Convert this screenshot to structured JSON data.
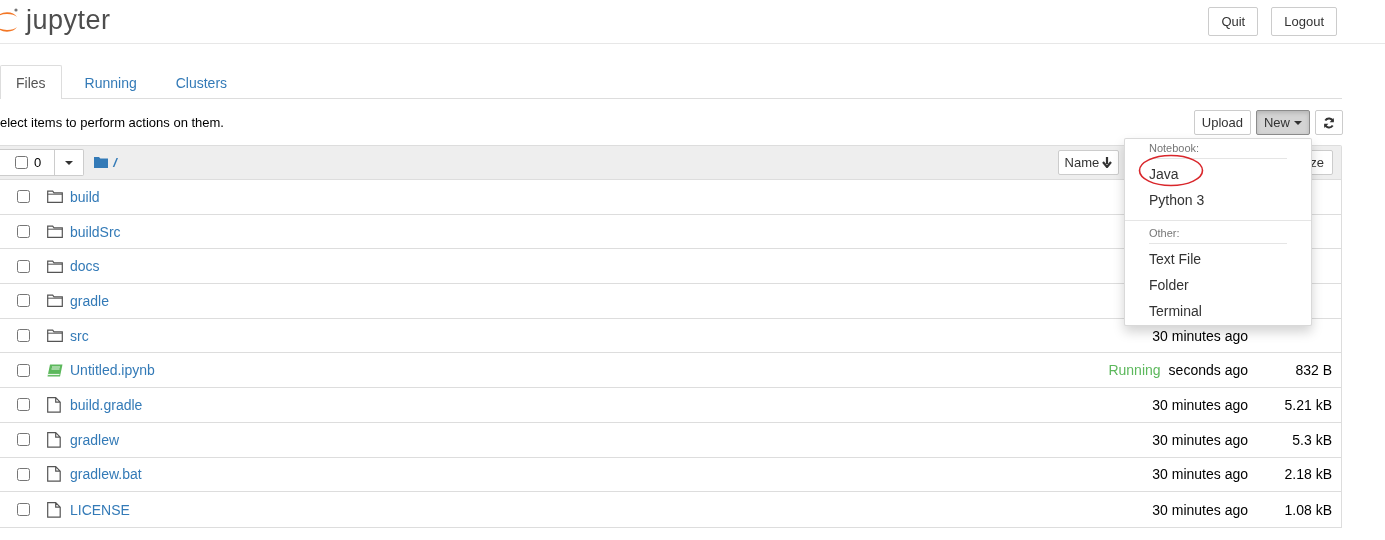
{
  "header": {
    "logo_text": "jupyter",
    "buttons": [
      "Quit",
      "Logout"
    ]
  },
  "tabs": [
    {
      "label": "Files",
      "selected": true
    },
    {
      "label": "Running",
      "selected": false
    },
    {
      "label": "Clusters",
      "selected": false
    }
  ],
  "toolbar": {
    "hint": "elect items to perform actions on them.",
    "buttons": [
      {
        "kind": "upload",
        "label": "Upload",
        "expanded": false
      },
      {
        "kind": "new",
        "label": "New",
        "expanded": true
      },
      {
        "kind": "refresh",
        "expanded": false
      }
    ]
  },
  "list_header": {
    "all_checked": false,
    "selected_count": "0",
    "path": "/",
    "sort_button": "Name",
    "column_button": "ze"
  },
  "rows": [
    {
      "kind": "folder",
      "name": "build",
      "checked": false
    },
    {
      "kind": "folder",
      "name": "buildSrc",
      "checked": false
    },
    {
      "kind": "folder",
      "name": "docs",
      "checked": false
    },
    {
      "kind": "folder",
      "name": "gradle",
      "checked": false
    },
    {
      "kind": "folder",
      "name": "src",
      "checked": false,
      "modified": "30 minutes ago"
    },
    {
      "kind": "notebook",
      "name": "Untitled.ipynb",
      "checked": false,
      "status": "Running",
      "modified": "seconds ago",
      "size": "832 B"
    },
    {
      "kind": "file",
      "name": "build.gradle",
      "checked": false,
      "modified": "30 minutes ago",
      "size": "5.21 kB"
    },
    {
      "kind": "file",
      "name": "gradlew",
      "checked": false,
      "modified": "30 minutes ago",
      "size": "5.3 kB"
    },
    {
      "kind": "file",
      "name": "gradlew.bat",
      "checked": false,
      "modified": "30 minutes ago",
      "size": "2.18 kB"
    },
    {
      "kind": "file",
      "name": "LICENSE",
      "checked": false,
      "modified": "30 minutes ago",
      "size": "1.08 kB"
    }
  ],
  "new_menu": {
    "sections": [
      {
        "heading": "Notebook:",
        "items": [
          {
            "label": "Java",
            "circled": true
          },
          {
            "label": "Python 3",
            "circled": false
          }
        ]
      },
      {
        "heading": "Other:",
        "items": [
          {
            "label": "Text File",
            "circled": false
          },
          {
            "label": "Folder",
            "circled": false
          },
          {
            "label": "Terminal",
            "circled": false
          }
        ]
      }
    ]
  }
}
